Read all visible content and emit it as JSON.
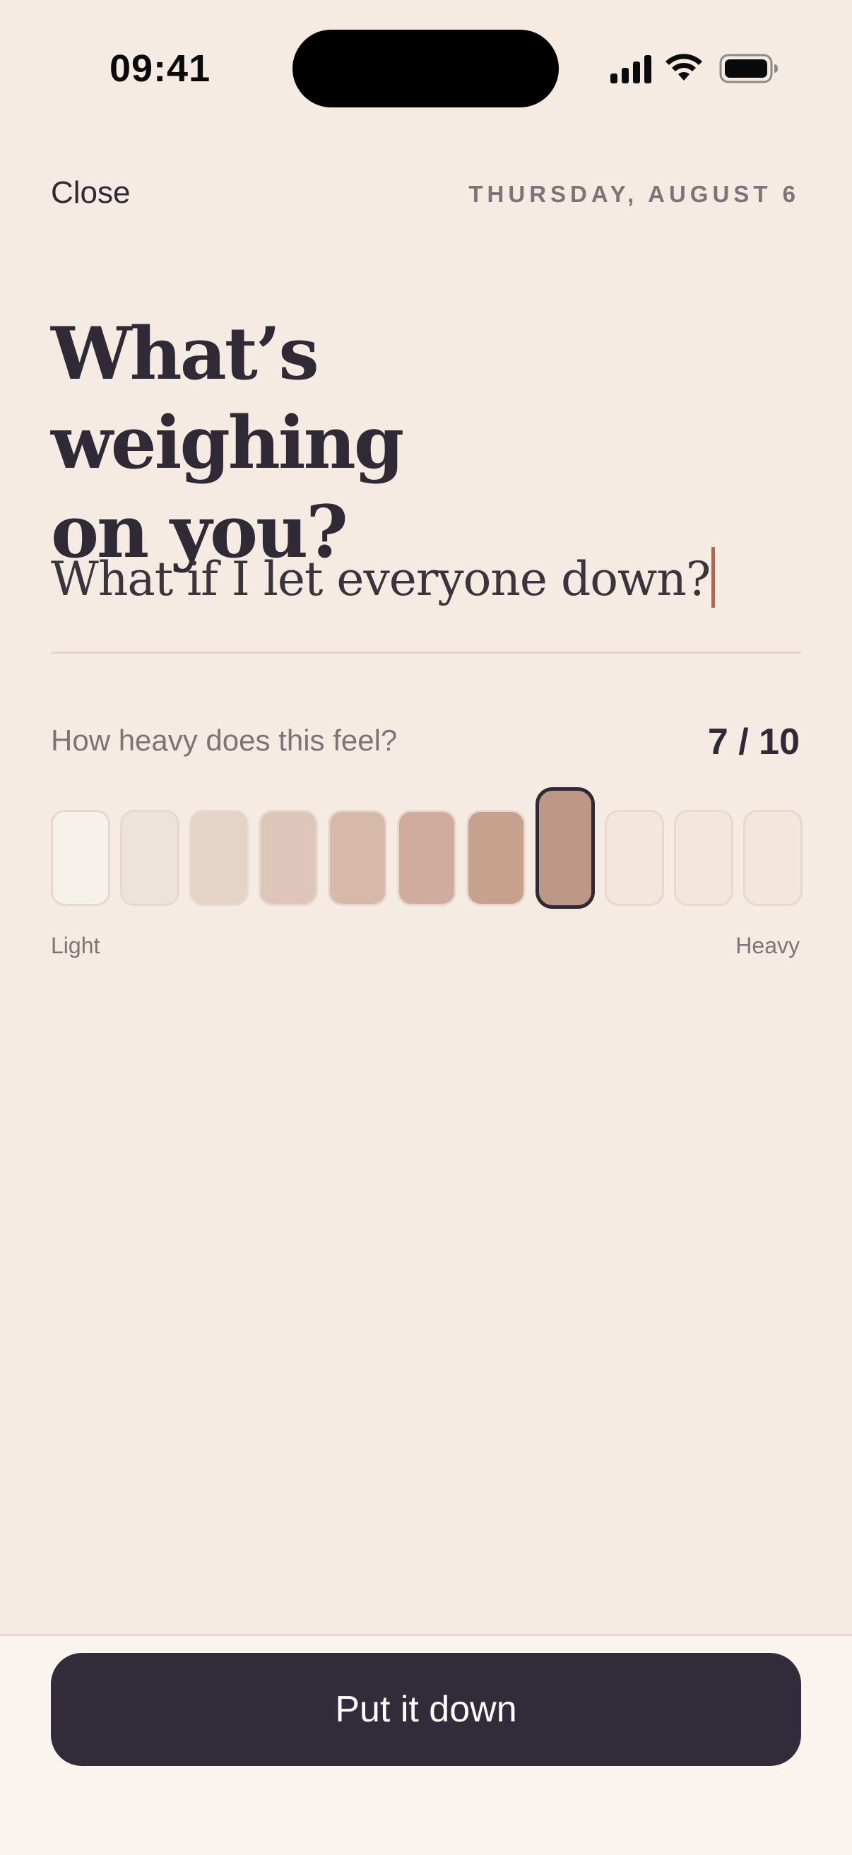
{
  "status_bar": {
    "time": "09:41",
    "icons": [
      "signal-icon",
      "wifi-icon",
      "battery-icon"
    ]
  },
  "header": {
    "close_label": "Close",
    "date": "THURSDAY, AUGUST 6"
  },
  "title": "What’s weighing on you?",
  "worry_input": {
    "value": "What if I let everyone down?"
  },
  "heaviness": {
    "question": "How heavy does this feel?",
    "score_text": "7 / 10",
    "selected": 8,
    "max": 10,
    "min_label": "Light",
    "max_label": "Heavy",
    "cells": [
      {
        "color": "#F7F1EC",
        "state": "filled"
      },
      {
        "color": "#EEE3DC",
        "state": "filled"
      },
      {
        "color": "#E6D3C8",
        "state": "filled"
      },
      {
        "color": "#DFC6BA",
        "state": "filled"
      },
      {
        "color": "#D7B9AA",
        "state": "filled"
      },
      {
        "color": "#CFAC9E",
        "state": "filled"
      },
      {
        "color": "#C6A18E",
        "state": "filled"
      },
      {
        "color": "#BE9886",
        "state": "selected"
      },
      {
        "color": "#F3E7DD",
        "state": "empty"
      },
      {
        "color": "#F3E7DD",
        "state": "empty"
      },
      {
        "color": "#F3E7DD",
        "state": "empty"
      }
    ]
  },
  "action": {
    "button_label": "Put it down"
  },
  "colors": {
    "background": "#F5EBE3",
    "ink": "#2F2A35",
    "muted": "#7D7378",
    "cursor": "#B5654C",
    "button": "#322B3A"
  }
}
